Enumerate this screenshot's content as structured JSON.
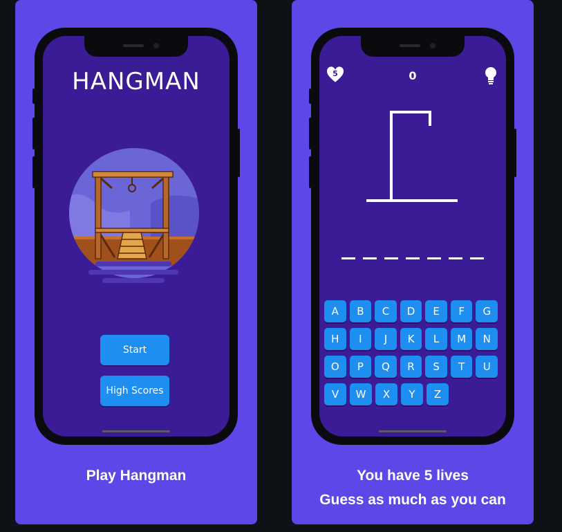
{
  "left_panel": {
    "title": "HANGMAN",
    "start_label": "Start",
    "high_scores_label": "High Scores",
    "caption": "Play Hangman"
  },
  "right_panel": {
    "lives": "5",
    "score": "0",
    "blank_count": 7,
    "keyboard": [
      [
        "A",
        "B",
        "C",
        "D",
        "E",
        "F",
        "G"
      ],
      [
        "H",
        "I",
        "J",
        "K",
        "L",
        "M",
        "N"
      ],
      [
        "O",
        "P",
        "Q",
        "R",
        "S",
        "T",
        "U"
      ],
      [
        "V",
        "W",
        "X",
        "Y",
        "Z"
      ]
    ],
    "caption_line1": "You have 5 lives",
    "caption_line2": "Guess as much as you can"
  },
  "colors": {
    "card": "#5d47e6",
    "screen": "#3b1b96",
    "button": "#1e8ef0"
  },
  "icons": {
    "lives": "heart-icon",
    "hint": "lightbulb-icon"
  }
}
